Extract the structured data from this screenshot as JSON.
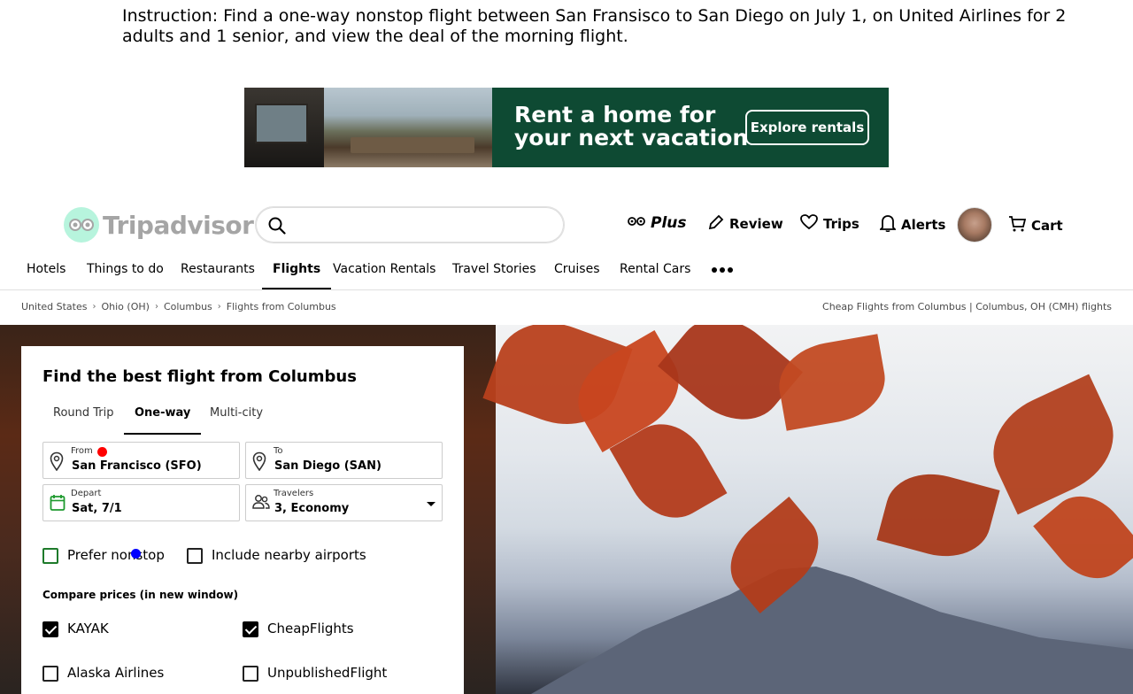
{
  "instruction": "Instruction: Find a one-way nonstop flight between San Fransisco to San Diego on July 1, on United Airlines for 2 adults and 1 senior, and view the deal of the morning flight.",
  "ad": {
    "headline_line1": "Rent a home for",
    "headline_line2": "your next vacation",
    "button": "Explore rentals"
  },
  "header": {
    "logo": "Tripadvisor",
    "search_placeholder": "",
    "plus_label": "Plus",
    "review": "Review",
    "trips": "Trips",
    "alerts": "Alerts",
    "cart": "Cart"
  },
  "nav": {
    "tabs": [
      "Hotels",
      "Things to do",
      "Restaurants",
      "Flights",
      "Vacation Rentals",
      "Travel Stories",
      "Cruises",
      "Rental Cars"
    ],
    "active": "Flights"
  },
  "breadcrumb": {
    "items": [
      "United States",
      "Ohio (OH)",
      "Columbus",
      "Flights from Columbus"
    ],
    "page_heading": "Cheap Flights from Columbus | Columbus, OH (CMH) flights"
  },
  "search_card": {
    "title": "Find the best flight from Columbus",
    "trip_types": [
      "Round Trip",
      "One-way",
      "Multi-city"
    ],
    "active_trip_type": "One-way",
    "from_label": "From",
    "from_value": "San Francisco (SFO)",
    "to_label": "To",
    "to_value": "San Diego (SAN)",
    "depart_label": "Depart",
    "depart_value": "Sat, 7/1",
    "travelers_label": "Travelers",
    "travelers_value": "3, Economy",
    "prefer_nonstop": "Prefer nonstop",
    "nearby": "Include nearby airports",
    "compare_title": "Compare prices (in new window)",
    "compare": [
      {
        "label": "KAYAK",
        "checked": true
      },
      {
        "label": "CheapFlights",
        "checked": true
      },
      {
        "label": "Alaska Airlines",
        "checked": false
      },
      {
        "label": "UnpublishedFlight",
        "checked": false
      }
    ]
  },
  "colors": {
    "ad_bg": "#0e4a33",
    "marker_red": "#ff0000",
    "marker_blue": "#0000ff",
    "nonstop_border": "#1e7a2b",
    "depart_icon": "#1e9a2e"
  }
}
